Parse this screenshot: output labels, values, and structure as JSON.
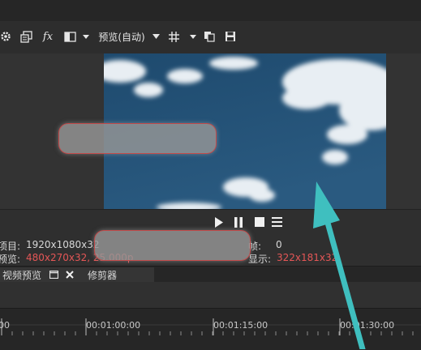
{
  "toolbar": {
    "preview_mode": "预览(自动)",
    "icons": [
      "gear-icon",
      "device-icon",
      "fx-icon",
      "split-icon",
      "dropdown-icon",
      "grid-icon",
      "dropdown-icon",
      "copy-icon",
      "save-icon"
    ]
  },
  "info": {
    "project_label": "项目:",
    "project_value": "1920x1080x32",
    "preview_label": "预览:",
    "preview_value": "480x270x32, 25.000p",
    "frame_label": "帧:",
    "frame_value": "0",
    "display_label": "显示:",
    "display_value": "322x181x32"
  },
  "tabs": {
    "video_preview": "视频预览",
    "trimmer": "修剪器"
  },
  "timeline": {
    "t0": "00",
    "t1": "00:01:00:00",
    "t2": "00:01:15:00",
    "t3": "00:01:30:00"
  },
  "colors": {
    "accent_red": "#e45656",
    "arrow": "#3fbfbf"
  }
}
